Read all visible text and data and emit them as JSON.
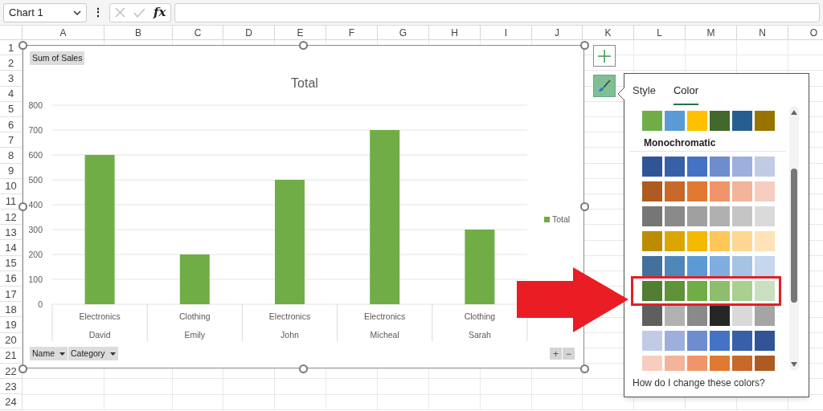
{
  "formula_bar": {
    "name_box": "Chart 1",
    "more": "⋮",
    "function_label": "fx"
  },
  "columns": [
    "A",
    "B",
    "C",
    "D",
    "E",
    "F",
    "G",
    "H",
    "I",
    "J",
    "K",
    "L",
    "M",
    "N",
    "O"
  ],
  "rows": [
    "1",
    "2",
    "3",
    "4",
    "5",
    "6",
    "7",
    "8",
    "9",
    "10",
    "11",
    "12",
    "13",
    "14",
    "15",
    "16",
    "17",
    "18",
    "19",
    "20",
    "21",
    "22",
    "23",
    "24"
  ],
  "chart": {
    "value_field": "Sum of Sales",
    "axis_fields": [
      "Name",
      "Category"
    ],
    "zoom_buttons": [
      "+",
      "−"
    ],
    "category_row": [
      "Electronics",
      "Clothing",
      "Electronics",
      "Electronics",
      "Clothing"
    ],
    "chart_data": {
      "type": "bar",
      "title": "Total",
      "grid": true,
      "categories": [
        "David",
        "Emily",
        "John",
        "Micheal",
        "Sarah"
      ],
      "series": [
        {
          "name": "Total",
          "color": "#70ad47",
          "values": [
            600,
            200,
            500,
            700,
            300
          ]
        }
      ],
      "ylim": [
        0,
        800
      ],
      "yticks": [
        0,
        100,
        200,
        300,
        400,
        500,
        600,
        700,
        800
      ]
    }
  },
  "color_panel": {
    "tabs": [
      {
        "label": "Style",
        "selected": false
      },
      {
        "label": "Color",
        "selected": true
      }
    ],
    "top_row": {
      "selected": false,
      "swatches": [
        {
          "color": "#70ad47"
        },
        {
          "color": "#5b9bd5"
        },
        {
          "color": "#ffc000"
        },
        {
          "color": "#43682b"
        },
        {
          "color": "#255e91"
        },
        {
          "color": "#997300"
        }
      ]
    },
    "section_title": "Monochromatic",
    "rows": [
      {
        "selected": false,
        "swatches": [
          {
            "color": "#2f5597"
          },
          {
            "color": "#3760a8"
          },
          {
            "color": "#4472c4"
          },
          {
            "color": "#6f8ccf"
          },
          {
            "color": "#9dafdc"
          },
          {
            "color": "#c2cbe6"
          }
        ]
      },
      {
        "selected": false,
        "swatches": [
          {
            "color": "#ae5a21"
          },
          {
            "color": "#c8682a"
          },
          {
            "color": "#e07a33"
          },
          {
            "color": "#f0956a"
          },
          {
            "color": "#f4b39b"
          },
          {
            "color": "#f7cdbf"
          }
        ]
      },
      {
        "selected": false,
        "swatches": [
          {
            "color": "#767676"
          },
          {
            "color": "#8a8a8a"
          },
          {
            "color": "#a0a0a0"
          },
          {
            "color": "#b0b0b0"
          },
          {
            "color": "#c5c5c5"
          },
          {
            "color": "#dadada"
          }
        ]
      },
      {
        "selected": false,
        "swatches": [
          {
            "color": "#bc8c00"
          },
          {
            "color": "#dca600"
          },
          {
            "color": "#f4b900"
          },
          {
            "color": "#ffc659"
          },
          {
            "color": "#ffd792"
          },
          {
            "color": "#ffe2b8"
          }
        ]
      },
      {
        "selected": false,
        "swatches": [
          {
            "color": "#41719c"
          },
          {
            "color": "#4e86b9"
          },
          {
            "color": "#5b9bd5"
          },
          {
            "color": "#7fade0"
          },
          {
            "color": "#a5c3e5"
          },
          {
            "color": "#c5d6ee"
          }
        ]
      },
      {
        "selected": true,
        "swatches": [
          {
            "color": "#507e32"
          },
          {
            "color": "#5e9338"
          },
          {
            "color": "#70ad47"
          },
          {
            "color": "#8cbe6d"
          },
          {
            "color": "#a9d08e"
          },
          {
            "color": "#c9dfc0"
          }
        ]
      },
      {
        "selected": false,
        "swatches": [
          {
            "color": "#5f5f5f"
          },
          {
            "color": "#b1b1b1"
          },
          {
            "color": "#8a8a8a"
          },
          {
            "color": "#262626"
          },
          {
            "color": "#d9d9d9"
          },
          {
            "color": "#a5a5a5"
          }
        ]
      },
      {
        "selected": false,
        "swatches": [
          {
            "color": "#c2cbe6"
          },
          {
            "color": "#9dafdc"
          },
          {
            "color": "#6f8ccf"
          },
          {
            "color": "#4472c4"
          },
          {
            "color": "#3760a8"
          },
          {
            "color": "#2f5597"
          }
        ]
      },
      {
        "selected": false,
        "swatches": [
          {
            "color": "#f7cdbf"
          },
          {
            "color": "#f4b39b"
          },
          {
            "color": "#f0956a"
          },
          {
            "color": "#e07a33"
          },
          {
            "color": "#c8682a"
          },
          {
            "color": "#ae5a21"
          }
        ]
      }
    ],
    "help_link": "How do I change these colors?"
  }
}
